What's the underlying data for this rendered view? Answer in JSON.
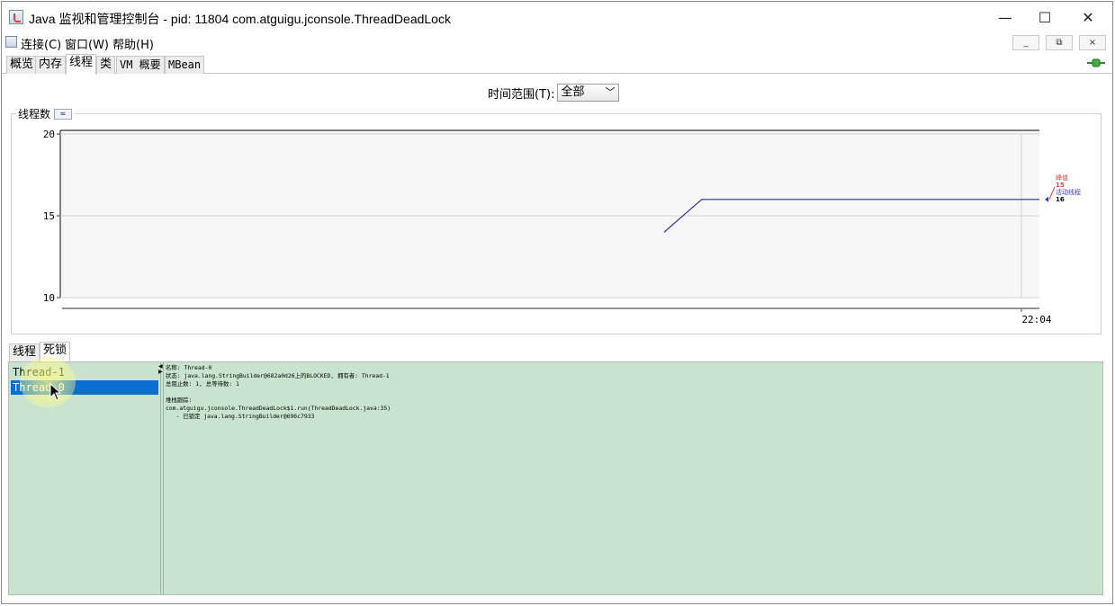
{
  "window": {
    "title": "Java 监视和管理控制台 - pid: 11804 com.atguigu.jconsole.ThreadDeadLock",
    "minimize_glyph": "—",
    "maximize_glyph": "☐",
    "close_glyph": "✕"
  },
  "menubar": {
    "items": [
      "连接(C)",
      "窗口(W)",
      "帮助(H)"
    ],
    "inner_controls": [
      "_",
      "⧉",
      "×"
    ]
  },
  "tabs": [
    {
      "label": "概览",
      "active": false
    },
    {
      "label": "内存",
      "active": false
    },
    {
      "label": "线程",
      "active": true
    },
    {
      "label": "类",
      "active": false
    },
    {
      "label": "VM 概要",
      "active": false
    },
    {
      "label": "MBean",
      "active": false
    }
  ],
  "time_range": {
    "label": "时间范围(T):",
    "selected": "全部",
    "chevron": "﹀"
  },
  "chart_panel": {
    "title": "线程数",
    "collapse_glyph": "≈"
  },
  "chart_data": {
    "type": "line",
    "ylim": [
      10,
      20
    ],
    "yticks": [
      "20",
      "15",
      "10"
    ],
    "xtick_label": "22:04",
    "series": [
      {
        "name": "活动线程",
        "color": "#2b2ba0",
        "points": [
          [
            0.0,
            14.0
          ],
          [
            0.1,
            16.0
          ],
          [
            1.0,
            16.0
          ]
        ]
      }
    ],
    "legend": [
      {
        "name": "峰值",
        "value": "15",
        "color": "#d93b3b"
      },
      {
        "name": "活动线程",
        "value": "16",
        "color": "#3a3ab0"
      }
    ]
  },
  "subtabs": [
    {
      "label": "线程",
      "active": false
    },
    {
      "label": "死锁",
      "active": true
    }
  ],
  "threads": [
    {
      "name": "Thread-1",
      "selected": false
    },
    {
      "name": "Thread-0",
      "selected": true
    }
  ],
  "details": {
    "lines": [
      "名称: Thread-0",
      "状态: java.lang.StringBuilder@682a0d26上的BLOCKED, 拥有者: Thread-1",
      "总阻止数: 1, 总等待数: 1",
      "",
      "堆栈跟踪:",
      "com.atguigu.jconsole.ThreadDeadLock$1.run(ThreadDeadLock.java:35)",
      "   - 已锁定 java.lang.StringBuilder@696c7933"
    ]
  },
  "colors": {
    "list_background": "#c8e4cf",
    "selection": "#0a6fd1",
    "series_line": "#2b2ba0"
  }
}
